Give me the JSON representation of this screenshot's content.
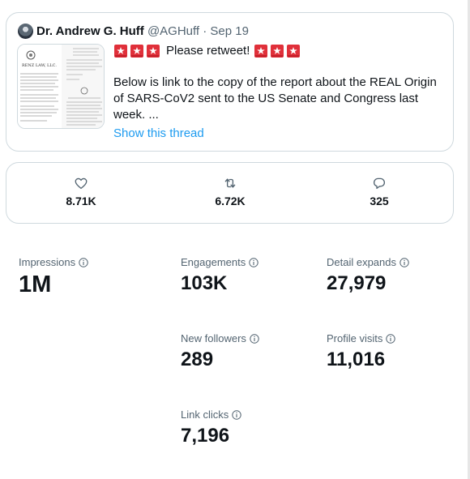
{
  "tweet": {
    "author_name": "Dr. Andrew G. Huff",
    "author_meta": "@AGHuff · Sep 19",
    "retweet_text": "Please retweet!",
    "body": "Below is link to the copy of the report about the REAL Origin of SARS-CoV2 sent to the US Senate and Congress last week. ...",
    "show_thread": "Show this thread",
    "thumbnail": {
      "letterhead": "RENZ LAW, LLC."
    }
  },
  "actions": {
    "likes": {
      "icon": "heart-icon",
      "count": "8.71K"
    },
    "retweets": {
      "icon": "retweet-icon",
      "count": "6.72K"
    },
    "replies": {
      "icon": "reply-icon",
      "count": "325"
    }
  },
  "metrics": [
    {
      "label": "Impressions",
      "value": "1M"
    },
    {
      "label": "Engagements",
      "value": "103K"
    },
    {
      "label": "Detail expands",
      "value": "27,979"
    },
    {
      "label": "New followers",
      "value": "289"
    },
    {
      "label": "Profile visits",
      "value": "11,016"
    },
    {
      "label": "Link clicks",
      "value": "7,196"
    }
  ],
  "colors": {
    "link": "#1d9bf0",
    "alarm": "#e0303a",
    "border": "#cfd9de",
    "muted": "#536471"
  }
}
